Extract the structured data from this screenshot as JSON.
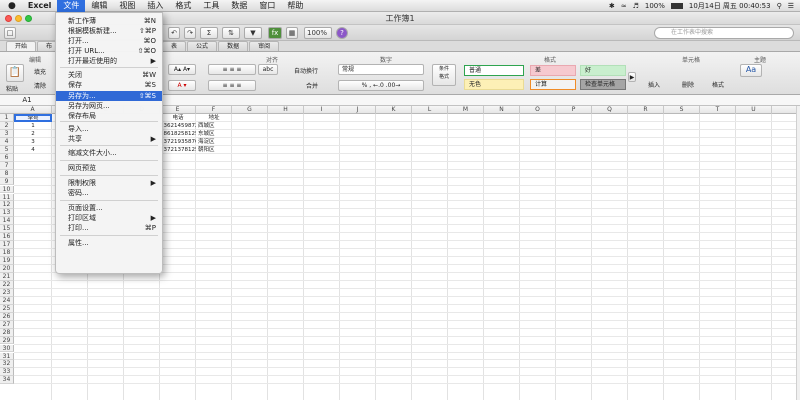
{
  "menubar": {
    "apple": "",
    "items": [
      "Excel",
      "文件",
      "编辑",
      "视图",
      "插入",
      "格式",
      "工具",
      "数据",
      "窗口",
      "帮助"
    ],
    "battery": "100%",
    "datetime": "10月14日 周五  00:40:53"
  },
  "window": {
    "title": "工作簿1"
  },
  "toolbar": {
    "zoom": "100%",
    "search_placeholder": "在工作表中搜索"
  },
  "ribbon": {
    "tabs": [
      "开始",
      "布",
      "表",
      "公式",
      "数据",
      "审阅"
    ],
    "groups": {
      "edit": "编辑",
      "align": "对齐",
      "number": "数字",
      "format": "格式",
      "cells": "单元格",
      "theme": "主题"
    },
    "paste": "粘贴",
    "fill": "填充",
    "clear": "清除",
    "wrap": "自动换行",
    "merge": "合并",
    "number_format": "常规",
    "cond_format": "条件\n格式",
    "styles": [
      {
        "label": "普通",
        "bg": "#ffffff",
        "border": "#2ea44f"
      },
      {
        "label": "差",
        "bg": "#f6c9cf",
        "border": "#e9a8b0"
      },
      {
        "label": "好",
        "bg": "#c9efce",
        "border": "#b2e0b8"
      },
      {
        "label": "无色",
        "bg": "#fdf0b6",
        "border": "#eadb94"
      },
      {
        "label": "计算",
        "bg": "#f3f3f3",
        "border": "#f08c28"
      },
      {
        "label": "检查单元格",
        "bg": "#a5a5a5",
        "border": "#777777"
      }
    ],
    "insert": "插入",
    "delete": "删除",
    "format_btn": "格式",
    "theme_btn": "Aa"
  },
  "formula": {
    "namebox": "A1"
  },
  "sheet": {
    "columns": [
      "A",
      "B",
      "C",
      "D",
      "E",
      "F",
      "G",
      "H",
      "I",
      "J",
      "K",
      "L",
      "M",
      "N",
      "O",
      "P",
      "Q",
      "R",
      "S",
      "T",
      "U"
    ],
    "rows": 34,
    "header_a1": "学号",
    "ids": [
      "1",
      "2",
      "3",
      "4"
    ],
    "e_header": "电话",
    "f_header": "地址",
    "phones": [
      "13621459872",
      "18618258125",
      "13721935876",
      "13721378125"
    ],
    "addresses": [
      "西城区",
      "东城区",
      "海淀区",
      "朝阳区"
    ]
  },
  "file_menu": {
    "items": [
      {
        "label": "新工作薄",
        "shortcut": "⌘N"
      },
      {
        "label": "根据模板新建...",
        "shortcut": "⇧⌘P"
      },
      {
        "label": "打开...",
        "shortcut": "⌘O"
      },
      {
        "label": "打开 URL...",
        "shortcut": "⇧⌘O"
      },
      {
        "label": "打开最近使用的",
        "shortcut": "▶"
      },
      {
        "label": "关闭",
        "shortcut": "⌘W"
      },
      {
        "label": "保存",
        "shortcut": "⌘S"
      },
      {
        "label": "另存为...",
        "shortcut": "⇧⌘S"
      },
      {
        "label": "另存为网页...",
        "shortcut": ""
      },
      {
        "label": "保存布局",
        "shortcut": ""
      },
      {
        "label": "导入...",
        "shortcut": ""
      },
      {
        "label": "共享",
        "shortcut": "▶"
      },
      {
        "label": "缩减文件大小...",
        "shortcut": ""
      },
      {
        "label": "网页预览",
        "shortcut": ""
      },
      {
        "label": "限制权限",
        "shortcut": "▶"
      },
      {
        "label": "密码...",
        "shortcut": ""
      },
      {
        "label": "页面设置...",
        "shortcut": ""
      },
      {
        "label": "打印区域",
        "shortcut": "▶"
      },
      {
        "label": "打印...",
        "shortcut": "⌘P"
      },
      {
        "label": "属性...",
        "shortcut": ""
      }
    ]
  },
  "colors": {
    "accent": "#3069d6",
    "menu_active": "#2f6fe0"
  }
}
